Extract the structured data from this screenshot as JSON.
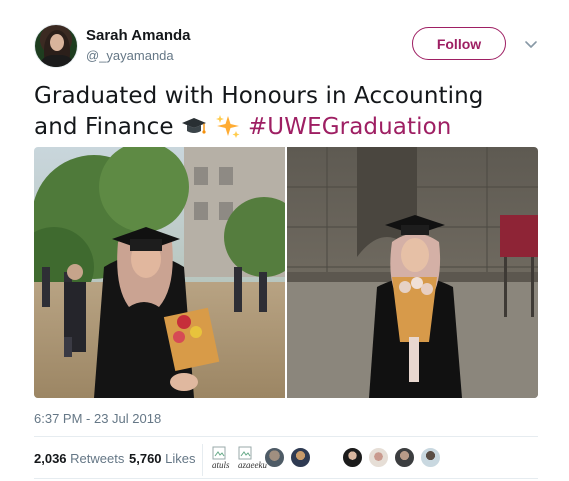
{
  "user": {
    "display_name": "Sarah Amanda",
    "handle": "@_yayamanda",
    "avatar_icon": "profile-photo-graduate"
  },
  "follow_button": {
    "label": "Follow"
  },
  "menu": {
    "icon": "chevron-down-icon"
  },
  "tweet": {
    "text_part1": "Graduated with Honours in Accounting and Finance ",
    "emoji_1": "graduation-cap-emoji",
    "emoji_2": "sparkles-emoji",
    "hashtag": "#UWEGraduation"
  },
  "media": {
    "photos": [
      {
        "description_icon": "photo-graduate-outdoor-crowd"
      },
      {
        "description_icon": "photo-graduate-church-wall"
      }
    ]
  },
  "timestamp": "6:37 PM - 23 Jul 2018",
  "stats": {
    "retweets_count": "2,036",
    "retweets_label": "Retweets",
    "likes_count": "5,760",
    "likes_label": "Likes"
  },
  "likers": {
    "broken_alt_1": "atuls",
    "broken_alt_2": "azaeeku"
  },
  "colors": {
    "accent": "#9e1f63",
    "secondary_text": "#657786",
    "primary_text": "#14171a",
    "border": "#e6ecf0"
  }
}
